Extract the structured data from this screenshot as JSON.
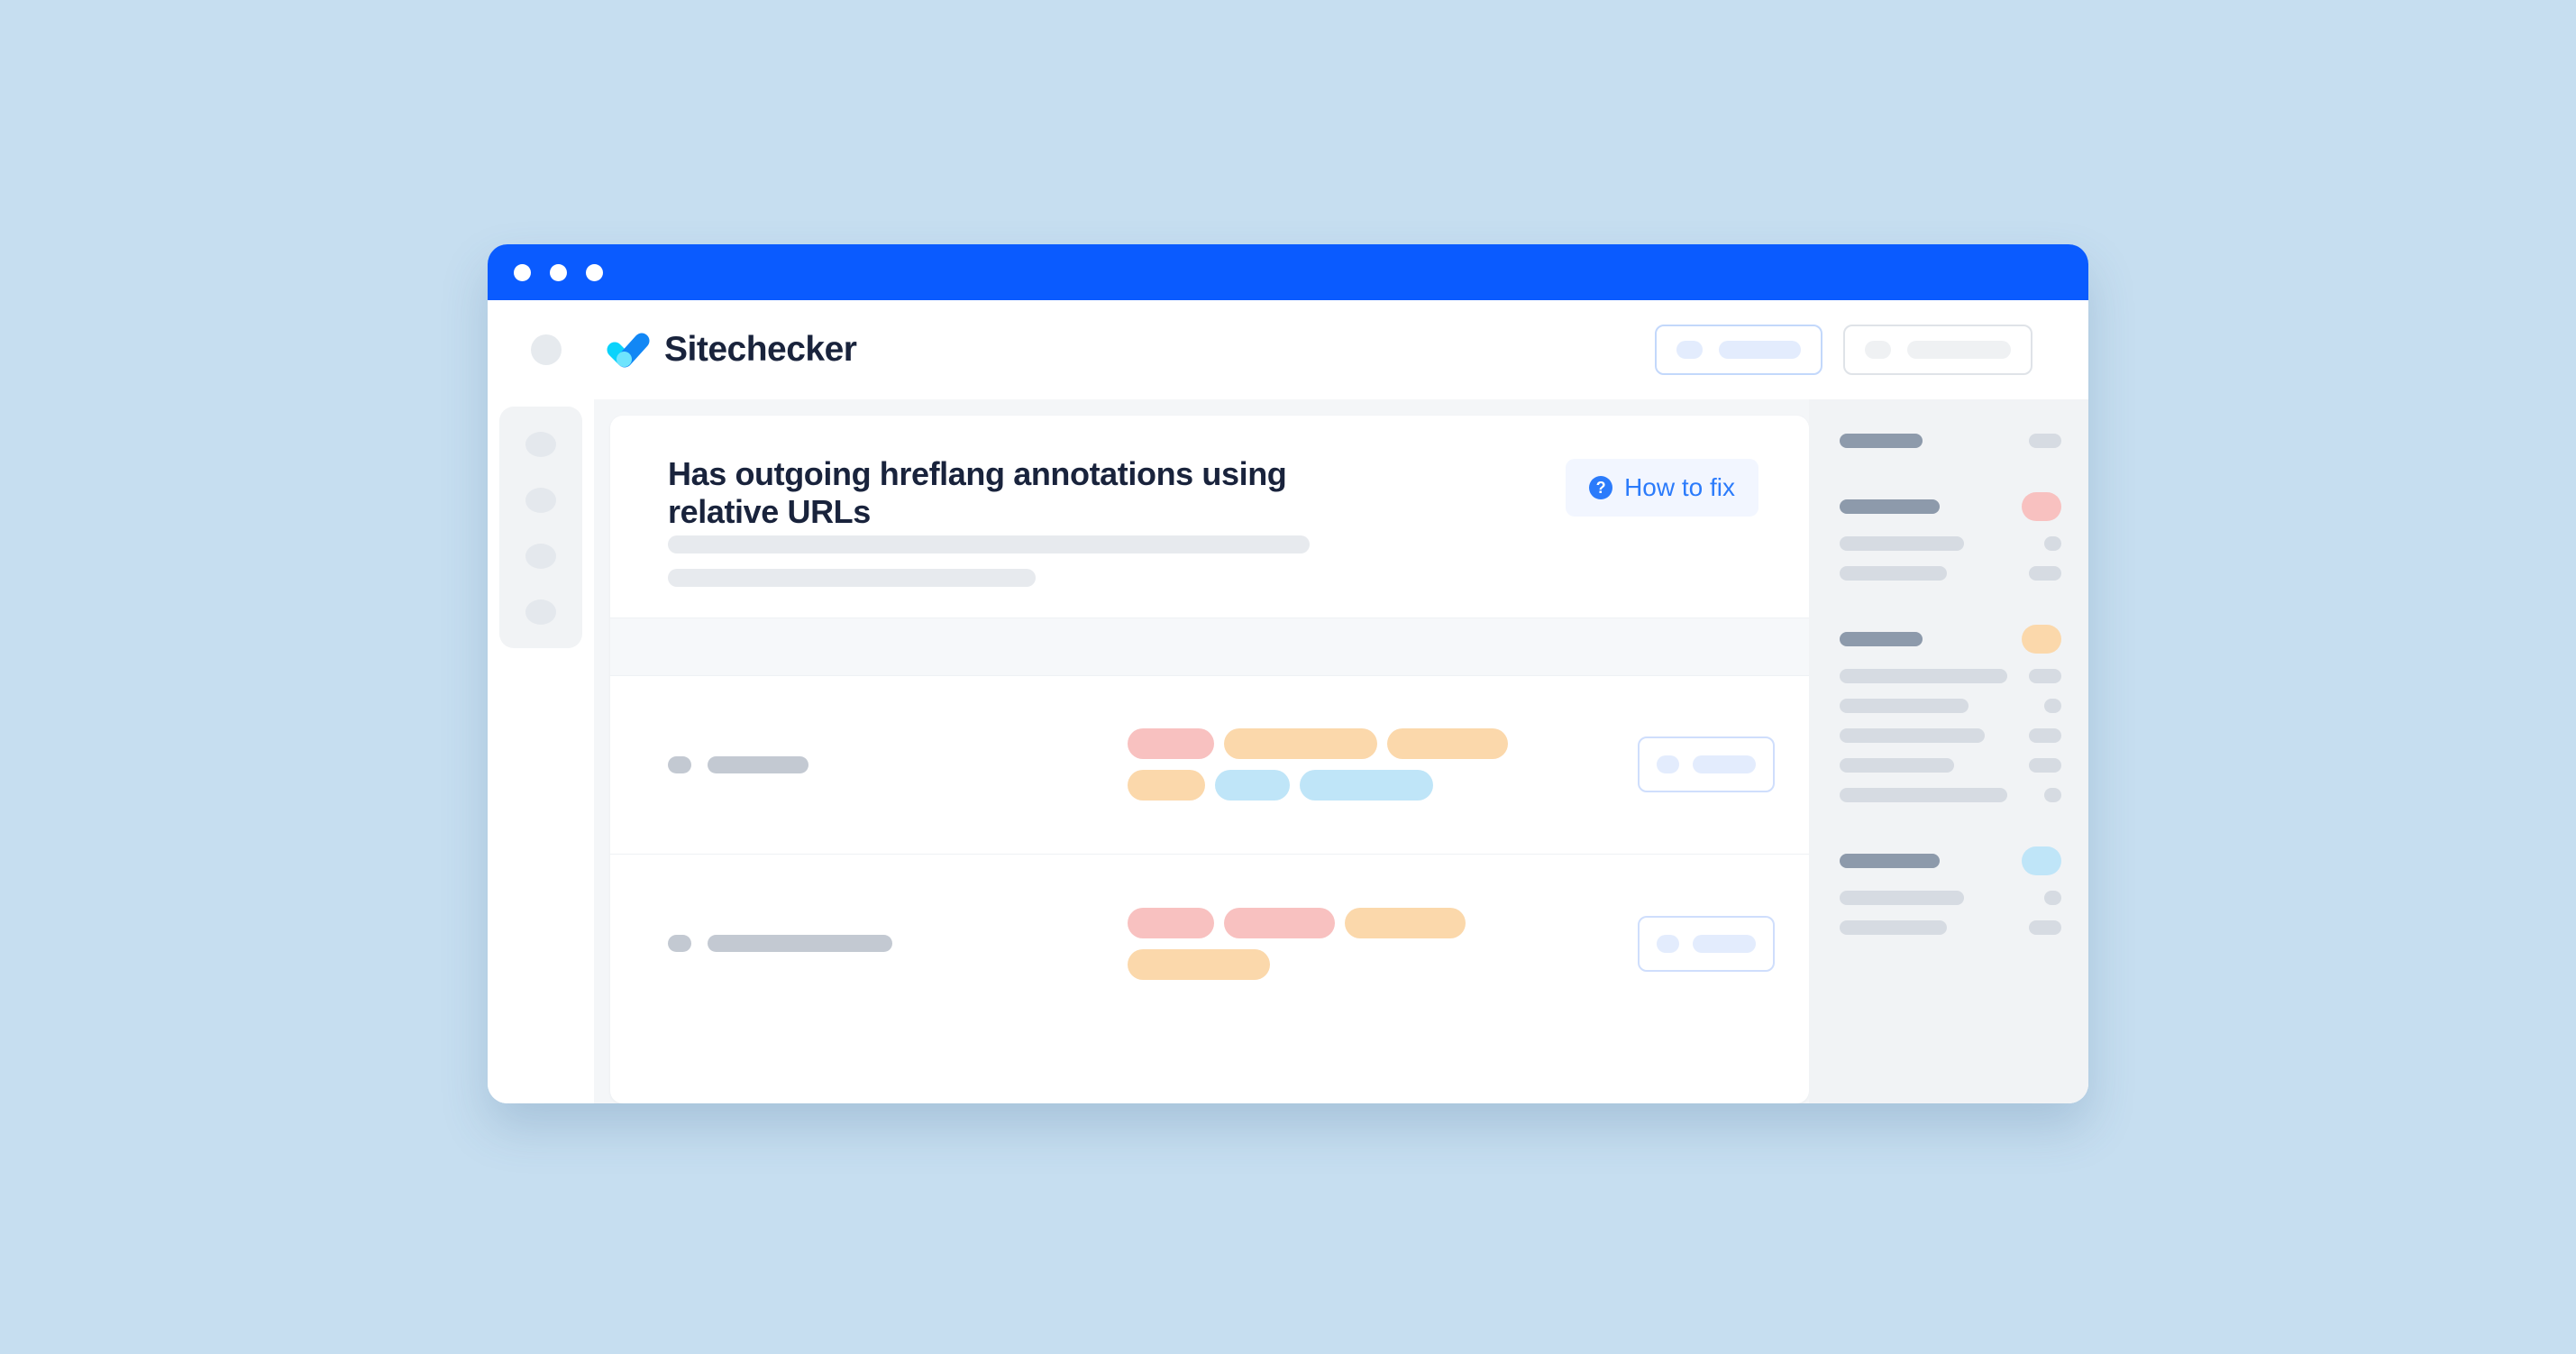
{
  "page": {
    "background_color": "#c6def0"
  },
  "window": {
    "titlebar": {
      "color": "#0a5bff",
      "dots": [
        "window-dot-1",
        "window-dot-2",
        "window-dot-3"
      ]
    }
  },
  "header": {
    "menu_icon": "hamburger-placeholder",
    "logo_icon": "sitechecker-checkmark-logo",
    "brand": "Sitechecker",
    "actions": [
      {
        "name": "primary-skeleton-button",
        "style": "blue-outline"
      },
      {
        "name": "secondary-skeleton-button",
        "style": "gray-outline"
      }
    ]
  },
  "left_rail": {
    "items": [
      {
        "name": "rail-item-1"
      },
      {
        "name": "rail-item-2"
      },
      {
        "name": "rail-item-3"
      },
      {
        "name": "rail-item-4"
      }
    ]
  },
  "main": {
    "card": {
      "title": "Has outgoing hreflang annotations using relative URLs",
      "subtitle_placeholders": [
        712,
        408
      ],
      "how_to_fix": {
        "icon": "question-mark-circle-icon",
        "icon_glyph": "?",
        "label": "How to fix"
      },
      "table": {
        "header_band": true,
        "rows": [
          {
            "name": "table-row-1",
            "label_width": 112,
            "tags": [
              {
                "color": "red",
                "width": 96
              },
              {
                "color": "orange",
                "width": 170
              },
              {
                "color": "orange",
                "width": 134
              },
              {
                "color": "orange",
                "width": 86
              },
              {
                "color": "blue",
                "width": 83
              },
              {
                "color": "blue",
                "width": 148
              }
            ],
            "action": {
              "name": "row-action-button-1"
            }
          },
          {
            "name": "table-row-2",
            "label_width": 205,
            "tags": [
              {
                "color": "red",
                "width": 96
              },
              {
                "color": "red",
                "width": 123
              },
              {
                "color": "orange",
                "width": 134
              },
              {
                "color": "orange",
                "width": 158
              }
            ],
            "action": {
              "name": "row-action-button-2"
            }
          }
        ]
      }
    }
  },
  "right_panel": {
    "groups": [
      {
        "name": "right-panel-group-1",
        "lines": [
          {
            "label_width": 92,
            "strong": true,
            "marker": "pill",
            "marker_size": "w-lg"
          }
        ]
      },
      {
        "name": "right-panel-group-2",
        "lines": [
          {
            "label_width": 111,
            "strong": true,
            "marker": "pill",
            "marker_size": "big",
            "marker_color": "red"
          },
          {
            "label_width": 138,
            "strong": false,
            "marker": "pill",
            "marker_size": "w-sm"
          },
          {
            "label_width": 119,
            "strong": false,
            "marker": "pill",
            "marker_size": "w-lg"
          }
        ]
      },
      {
        "name": "right-panel-group-3",
        "lines": [
          {
            "label_width": 92,
            "strong": true,
            "marker": "pill",
            "marker_size": "big",
            "marker_color": "orange"
          },
          {
            "label_width": 186,
            "strong": false,
            "marker": "pill",
            "marker_size": "w-lg"
          },
          {
            "label_width": 143,
            "strong": false,
            "marker": "pill",
            "marker_size": "w-sm"
          },
          {
            "label_width": 161,
            "strong": false,
            "marker": "pill",
            "marker_size": "w-lg"
          },
          {
            "label_width": 127,
            "strong": false,
            "marker": "pill",
            "marker_size": "w-lg"
          },
          {
            "label_width": 186,
            "strong": false,
            "marker": "pill",
            "marker_size": "w-sm"
          }
        ]
      },
      {
        "name": "right-panel-group-4",
        "lines": [
          {
            "label_width": 111,
            "strong": true,
            "marker": "pill",
            "marker_size": "big",
            "marker_color": "blue"
          },
          {
            "label_width": 138,
            "strong": false,
            "marker": "pill",
            "marker_size": "w-sm"
          },
          {
            "label_width": 119,
            "strong": false,
            "marker": "pill",
            "marker_size": "w-lg"
          }
        ]
      }
    ]
  },
  "colors": {
    "accent_blue": "#2b7bfb",
    "titlebar_blue": "#0a5bff",
    "tag_red": "#f8c1c0",
    "tag_orange": "#fbd8ab",
    "tag_blue": "#bfe5f8",
    "skeleton_gray": "#d6dbe2",
    "skeleton_gray_strong": "#8d9aab",
    "page_bg": "#c6def0"
  }
}
